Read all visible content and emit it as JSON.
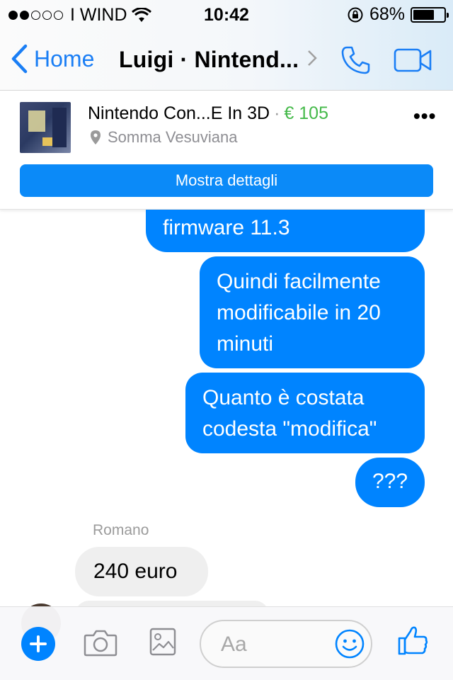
{
  "status_bar": {
    "carrier": "I WIND",
    "time": "10:42",
    "battery": "68%",
    "battery_level": 0.68,
    "signal_bars_filled": 2,
    "signal_bars_total": 5
  },
  "nav": {
    "back_label": "Home",
    "title": "Luigi · Nintend..."
  },
  "listing": {
    "title": "Nintendo  Con...E In 3D",
    "separator": "·",
    "price": "€ 105",
    "location": "Somma Vesuviana",
    "more_label": "•••",
    "details_button": "Mostra dettagli"
  },
  "messages": {
    "outgoing": [
      {
        "text": "firmware 11.3"
      },
      {
        "text": "Quindi facilmente modificabile in 20 minuti"
      },
      {
        "text": "Quanto è costata codesta \"modifica\""
      },
      {
        "text": "???"
      }
    ],
    "sender_name": "Romano",
    "incoming": [
      {
        "text": "240 euro"
      }
    ]
  },
  "composer": {
    "placeholder": "Aa"
  },
  "colors": {
    "accent": "#0084ff",
    "nav_blue": "#1a7ef5",
    "price_green": "#44b949",
    "incoming_bg": "#efefef"
  }
}
